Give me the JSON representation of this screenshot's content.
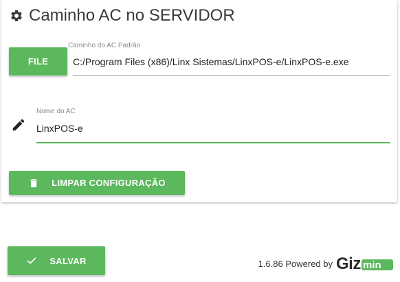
{
  "section": {
    "title": "Caminho AC no SERVIDOR",
    "icon": "gear-icon"
  },
  "path_field": {
    "button_label": "FILE",
    "label": "Caminho do AC Padrão",
    "value": "C:/Program Files (x86)/Linx Sistemas/LinxPOS-e/LinxPOS-e.exe"
  },
  "name_field": {
    "icon": "pencil-icon",
    "label": "Nome do AC",
    "value": "LinxPOS-e"
  },
  "clear_button": {
    "label": "LIMPAR CONFIGURAÇÃO",
    "icon": "trash-icon"
  },
  "save_button": {
    "label": "SALVAR",
    "icon": "check-icon"
  },
  "footer": {
    "version_text": "1.6.86 Powered by",
    "brand": "Gizmin"
  },
  "colors": {
    "accent": "#5cb85c",
    "brand_dark": "#2b2b2b"
  }
}
